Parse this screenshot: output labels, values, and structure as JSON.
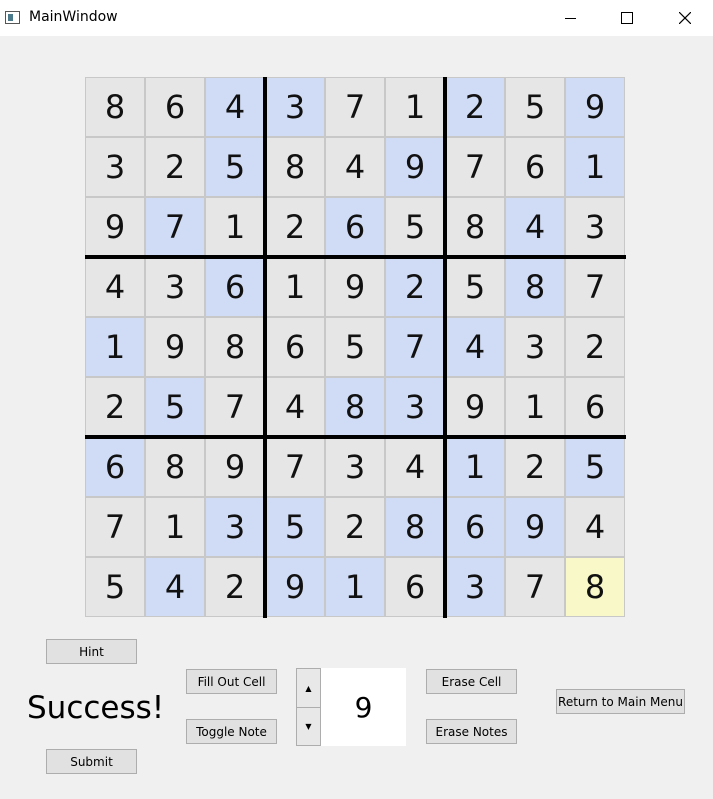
{
  "window": {
    "title": "MainWindow"
  },
  "board": {
    "values": [
      [
        8,
        6,
        4,
        3,
        7,
        1,
        2,
        5,
        9
      ],
      [
        3,
        2,
        5,
        8,
        4,
        9,
        7,
        6,
        1
      ],
      [
        9,
        7,
        1,
        2,
        6,
        5,
        8,
        4,
        3
      ],
      [
        4,
        3,
        6,
        1,
        9,
        2,
        5,
        8,
        7
      ],
      [
        1,
        9,
        8,
        6,
        5,
        7,
        4,
        3,
        2
      ],
      [
        2,
        5,
        7,
        4,
        8,
        3,
        9,
        1,
        6
      ],
      [
        6,
        8,
        9,
        7,
        3,
        4,
        1,
        2,
        5
      ],
      [
        7,
        1,
        3,
        5,
        2,
        8,
        6,
        9,
        4
      ],
      [
        5,
        4,
        2,
        9,
        1,
        6,
        3,
        7,
        8
      ]
    ],
    "shading": [
      [
        0,
        0,
        1,
        1,
        0,
        0,
        1,
        0,
        1
      ],
      [
        0,
        0,
        1,
        0,
        0,
        1,
        0,
        0,
        1
      ],
      [
        0,
        1,
        0,
        0,
        1,
        0,
        0,
        1,
        0
      ],
      [
        0,
        0,
        1,
        0,
        0,
        1,
        0,
        1,
        0
      ],
      [
        1,
        0,
        0,
        0,
        0,
        1,
        1,
        0,
        0
      ],
      [
        0,
        1,
        0,
        0,
        1,
        1,
        0,
        0,
        0
      ],
      [
        1,
        0,
        0,
        0,
        0,
        0,
        1,
        0,
        1
      ],
      [
        0,
        0,
        1,
        1,
        0,
        1,
        1,
        1,
        0
      ],
      [
        0,
        1,
        0,
        1,
        1,
        0,
        1,
        0,
        2
      ]
    ],
    "colors": {
      "plain": "#e6e6e6",
      "highlight": "#d0dcf5",
      "selected": "#f8f8c8"
    }
  },
  "controls": {
    "hint_label": "Hint",
    "status_text": "Success!",
    "submit_label": "Submit",
    "fill_label": "Fill Out Cell",
    "toggle_label": "Toggle Note",
    "spin_up_glyph": "▲",
    "spin_down_glyph": "▼",
    "spin_value": "9",
    "erase_cell_label": "Erase Cell",
    "erase_notes_label": "Erase Notes",
    "return_label": "Return to Main Menu"
  }
}
